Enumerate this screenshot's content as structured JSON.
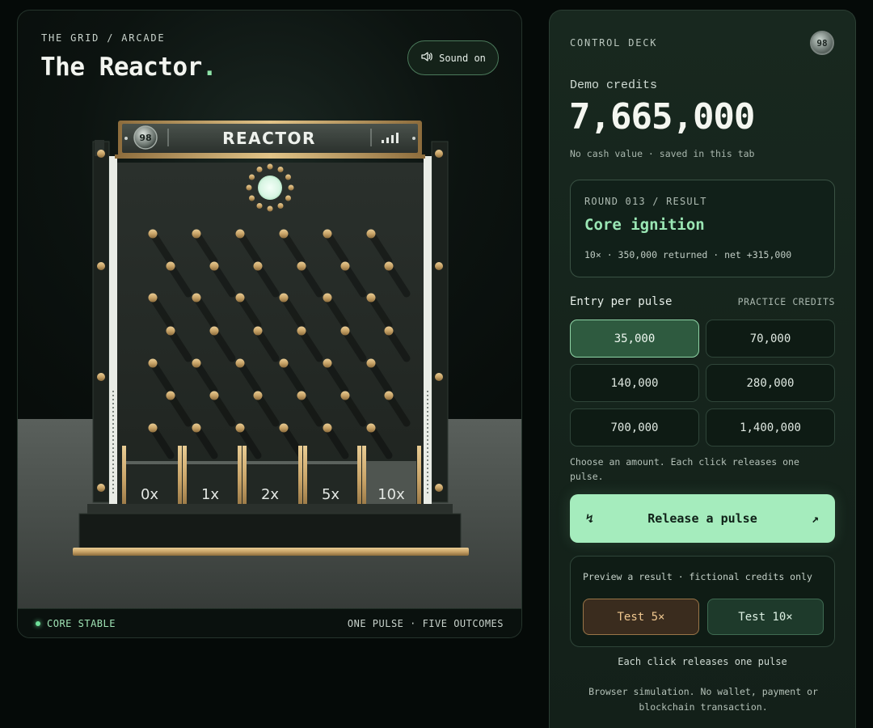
{
  "game": {
    "eyebrow": "THE GRID / ARCADE",
    "title": "The Reactor",
    "title_dot": ".",
    "sound_label": "Sound on",
    "machine": {
      "badge": "98",
      "name": "REACTOR",
      "buckets": [
        "0x",
        "1x",
        "2x",
        "5x",
        "10x"
      ],
      "highlighted_bucket": 4
    },
    "footer": {
      "status": "CORE STABLE",
      "right": "ONE PULSE · FIVE OUTCOMES"
    }
  },
  "control": {
    "label": "CONTROL DECK",
    "badge": "98",
    "credits_label": "Demo credits",
    "credits_value": "7,665,000",
    "credits_note": "No cash value · saved in this tab",
    "result": {
      "round": "ROUND 013 / RESULT",
      "title": "Core ignition",
      "detail": "10× · 350,000 returned · net +315,000"
    },
    "entry_label": "Entry per pulse",
    "practice_label": "PRACTICE CREDITS",
    "amounts": [
      "35,000",
      "70,000",
      "140,000",
      "280,000",
      "700,000",
      "1,400,000"
    ],
    "selected_amount": 0,
    "choose_note": "Choose an amount. Each click releases one pulse.",
    "release_label": "Release a pulse",
    "release_left_icon": "↯",
    "release_right_icon": "↗",
    "preview_note": "Preview a result · fictional credits only",
    "test_5": "Test 5×",
    "test_10": "Test 10×",
    "each_click": "Each click releases one pulse",
    "disclaimer": "Browser simulation. No wallet, payment or blockchain transaction."
  },
  "colors": {
    "accent": "#8ee3a8",
    "brass": "#c9a468",
    "release_button": "#a5ecbd"
  }
}
